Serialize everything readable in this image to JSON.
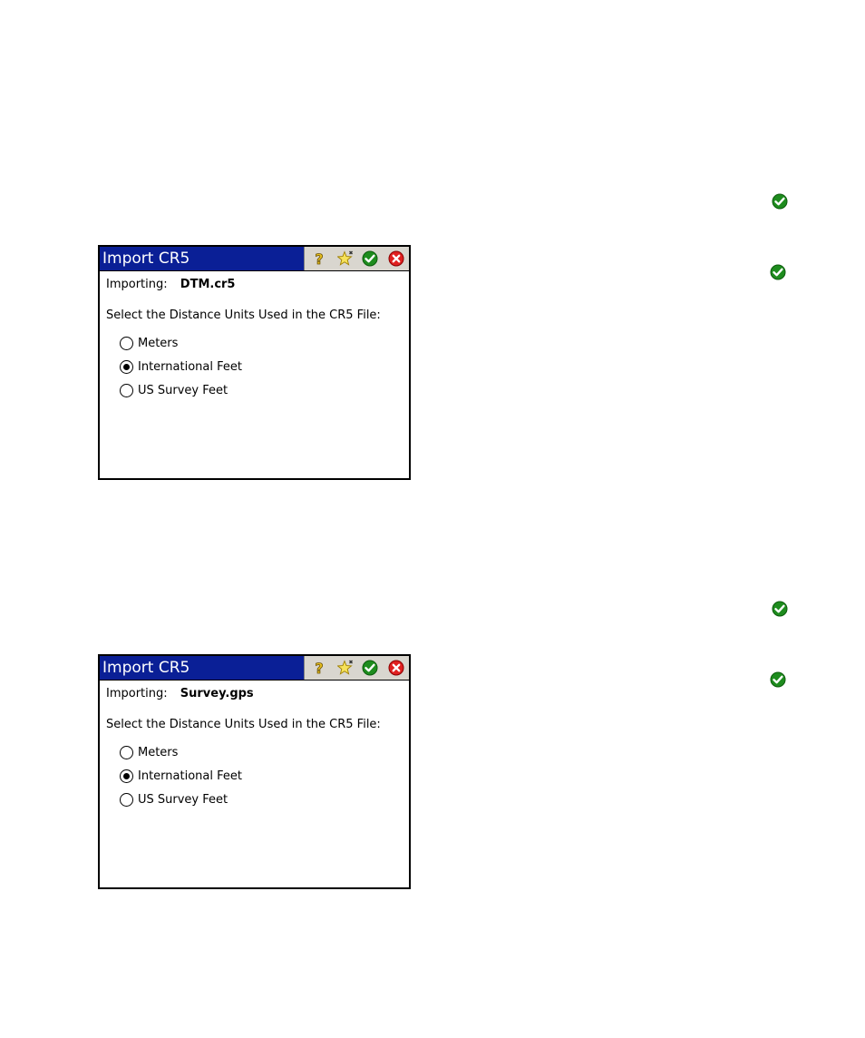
{
  "dialogs": [
    {
      "title": "Import CR5",
      "importing_label": "Importing:",
      "importing_file": "DTM.cr5",
      "units_prompt": "Select the Distance Units Used in the CR5 File:",
      "options": [
        {
          "label": "Meters",
          "selected": false
        },
        {
          "label": "International Feet",
          "selected": true
        },
        {
          "label": "US Survey Feet",
          "selected": false
        }
      ]
    },
    {
      "title": "Import CR5",
      "importing_label": "Importing:",
      "importing_file": "Survey.gps",
      "units_prompt": "Select the Distance Units Used in the CR5 File:",
      "options": [
        {
          "label": "Meters",
          "selected": false
        },
        {
          "label": "International Feet",
          "selected": true
        },
        {
          "label": "US Survey Feet",
          "selected": false
        }
      ]
    }
  ],
  "icons": {
    "help": "help-icon",
    "favorite": "favorites-icon",
    "ok": "ok-check-icon",
    "close": "close-x-icon",
    "side_marker": "check-circle-icon"
  },
  "colors": {
    "titlebar": "#0a1f96",
    "button_strip": "#d9d6cf",
    "ok_green": "#1e8c1e",
    "close_red": "#e02020",
    "help_yellow": "#e8c020"
  }
}
